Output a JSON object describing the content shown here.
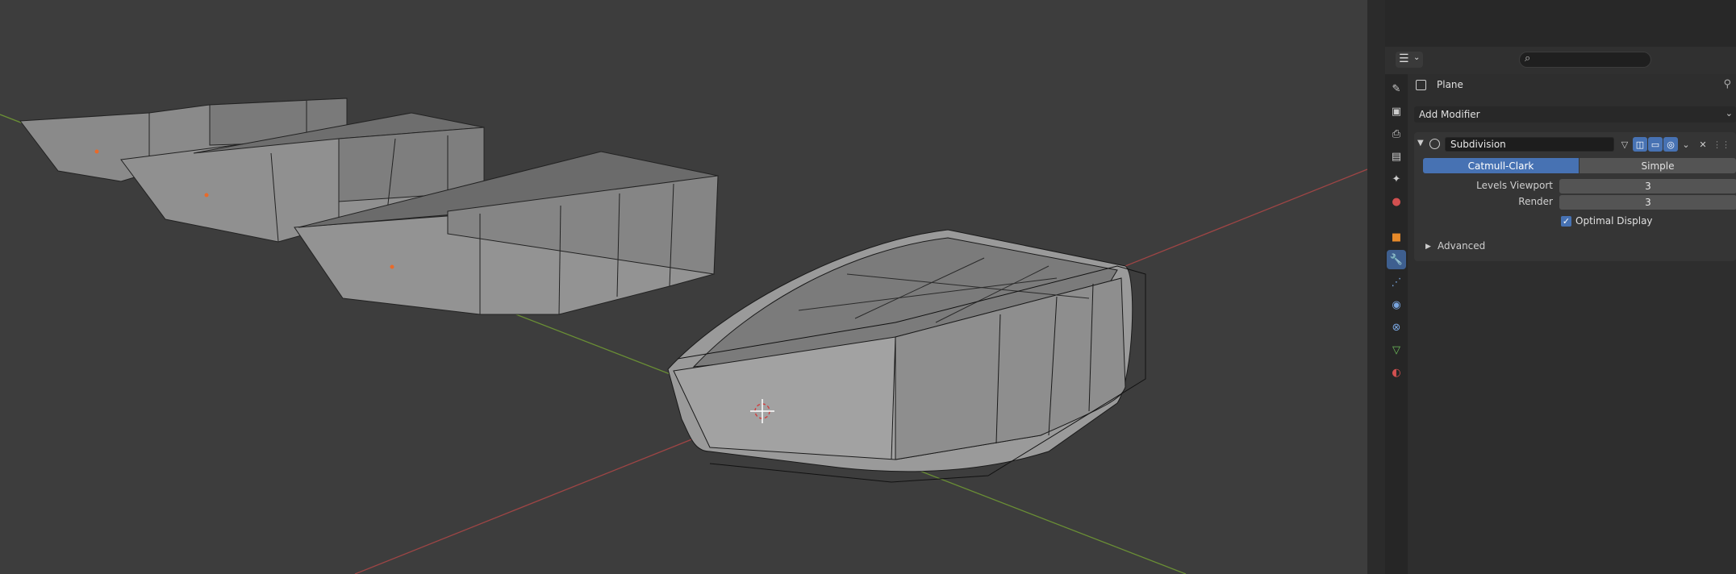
{
  "editor": {
    "object_name": "Plane",
    "add_modifier_label": "Add Modifier",
    "modifier": {
      "name": "Subdivision",
      "algorithms": [
        "Catmull-Clark",
        "Simple"
      ],
      "selected_algorithm": "Catmull-Clark",
      "levels_viewport_label": "Levels Viewport",
      "levels_viewport_value": "3",
      "render_label": "Render",
      "render_value": "3",
      "optimal_display_label": "Optimal Display",
      "optimal_display_checked": true,
      "advanced_label": "Advanced"
    }
  },
  "tabs": [
    "tool-icon",
    "render-icon",
    "output-icon",
    "view-layer-icon",
    "scene-icon",
    "world-icon",
    "object-icon",
    "modifier-icon",
    "particles-icon",
    "physics-icon",
    "constraints-icon",
    "data-icon",
    "material-icon"
  ],
  "colors": {
    "accent": "#4772b3",
    "x_axis": "#b34a4a",
    "y_axis": "#6e9a3a",
    "mesh_surface": "#8c8c8c"
  }
}
